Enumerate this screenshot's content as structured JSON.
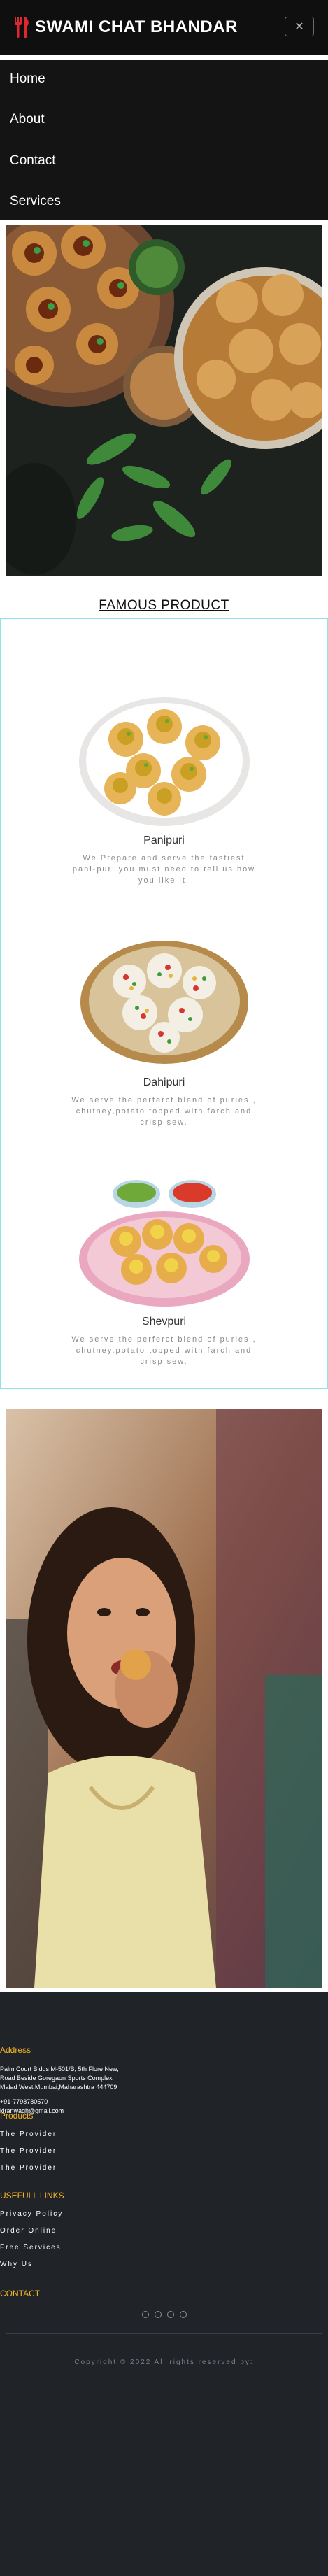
{
  "header": {
    "brand": "SWAMI CHAT BHANDAR",
    "brand_icon": "fork-knife-icon",
    "toggle_icon": "close-icon",
    "toggle_label": "✕",
    "accent": "#e0262e"
  },
  "nav": {
    "items": [
      {
        "label": "Home"
      },
      {
        "label": "About"
      },
      {
        "label": "Contact"
      },
      {
        "label": "Services"
      }
    ]
  },
  "famous": {
    "title": "FAMOUS PRODUCT",
    "products": [
      {
        "name": "Panipuri",
        "desc": "We Prepare and serve the tastiest pani-puri you must need to tell us how you like it."
      },
      {
        "name": "Dahipuri",
        "desc": "We serve the perferct blend of puries , chutney,potato topped with farch and crisp sew."
      },
      {
        "name": "Shevpuri",
        "desc": "We serve the perferct blend of puries , chutney,potato topped with farch and crisp sew."
      }
    ]
  },
  "footer": {
    "address_head": "Address",
    "address_lines": [
      "Palm Court Bldgs M-501/B, 5th Flore New,",
      "Road Beside Goregaon Sports Complex",
      "Malad West,Mumbai,Maharashtra 444709"
    ],
    "phone": "+91-7798780570",
    "email": "kiranwagh@gmail.com",
    "products_head": "Products",
    "products": [
      "The Provider",
      "The Provider",
      "The Provider"
    ],
    "useful_head": "USEFULL LINKS",
    "useful": [
      "Privacy Policy",
      "Order Online",
      "Free Services",
      "Why Us"
    ],
    "contact_head": "CONTACT",
    "social_icons": [
      "instagram-icon",
      "facebook-icon",
      "google-icon",
      "github-icon"
    ],
    "copyright": "Copyright © 2022 All rights reserved by:",
    "accent": "#f5b526"
  }
}
